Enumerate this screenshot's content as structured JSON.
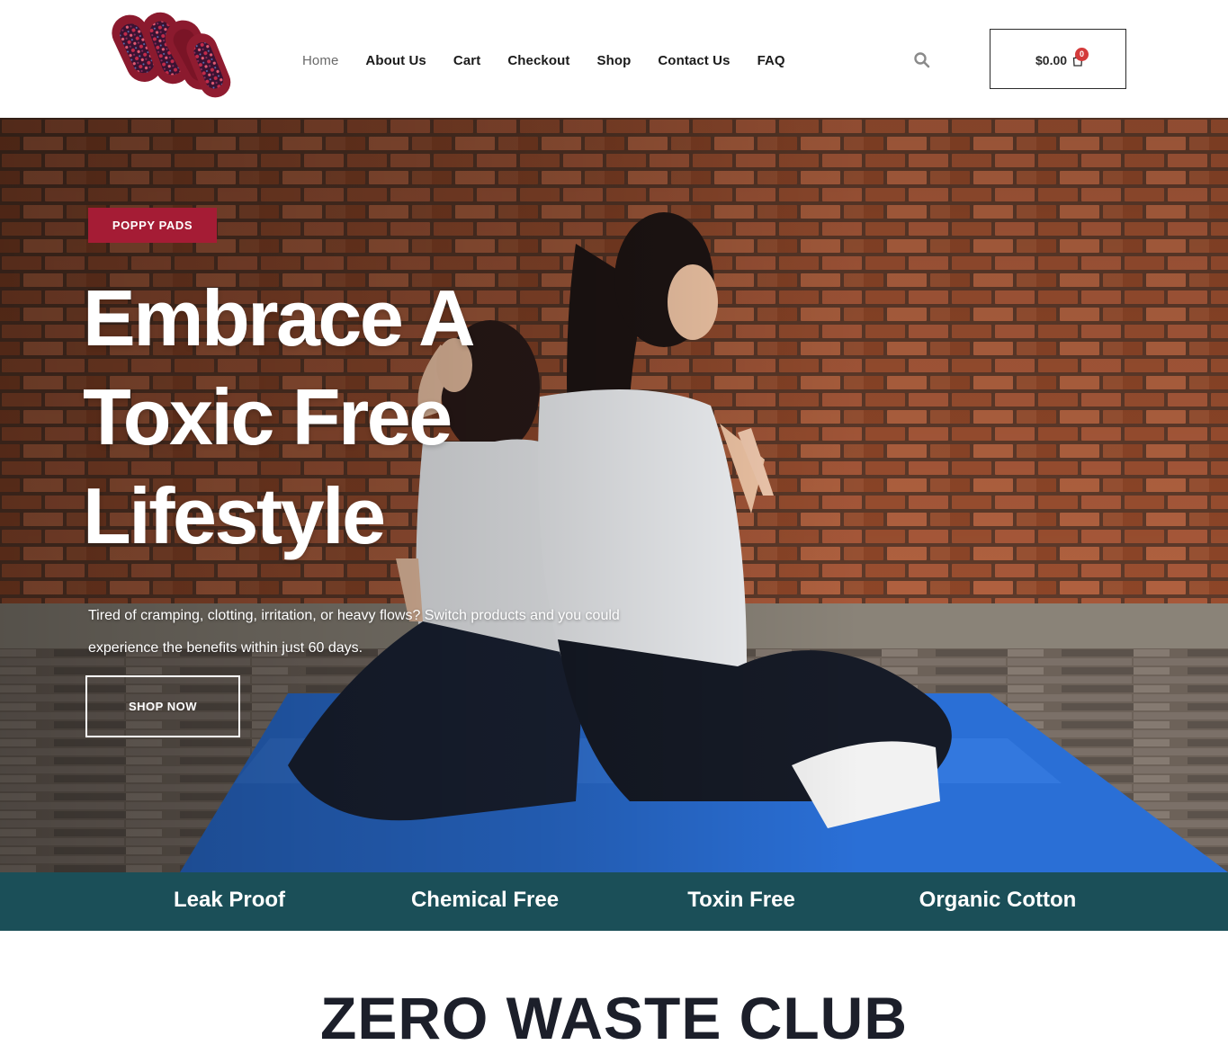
{
  "header": {
    "logo_icon": "stacked-cloth-pads-logo",
    "nav": [
      {
        "label": "Home",
        "active": true
      },
      {
        "label": "About Us"
      },
      {
        "label": "Cart"
      },
      {
        "label": "Checkout"
      },
      {
        "label": "Shop"
      },
      {
        "label": "Contact Us"
      },
      {
        "label": "FAQ"
      }
    ],
    "search_icon": "search-icon",
    "cart": {
      "total": "$0.00",
      "count": "0",
      "icon": "shopping-bag-icon"
    }
  },
  "hero": {
    "badge": "POPPY PADS",
    "title_lines": [
      "Embrace A",
      "Toxic Free",
      "Lifestyle"
    ],
    "subtitle": "Tired of cramping, clotting, irritation, or heavy flows? Switch products and you could experience the benefits within just 60 days.",
    "button": "SHOP NOW"
  },
  "features": [
    "Leak Proof",
    "Chemical Free",
    "Toxin Free",
    "Organic Cotton"
  ],
  "section": {
    "title": "ZERO WASTE CLUB"
  },
  "colors": {
    "brand": "#a51c35",
    "features_bar": "#1b4f58",
    "cart_badge": "#d43b3b",
    "heading_dark": "#1c1f2a"
  }
}
